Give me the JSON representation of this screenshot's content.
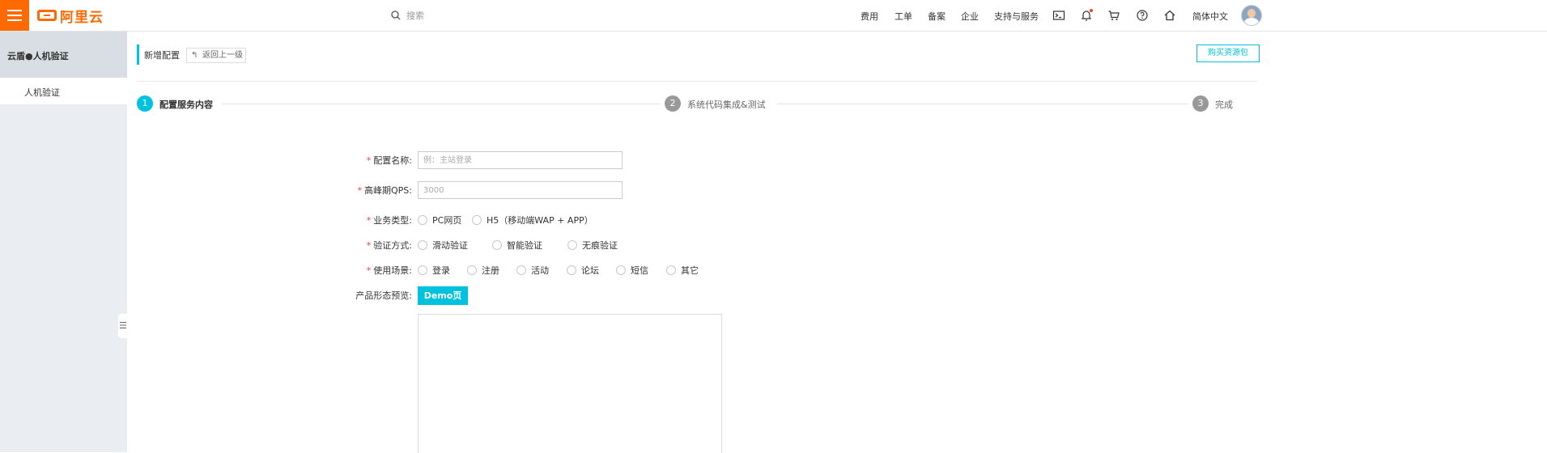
{
  "header": {
    "logo_text": "阿里云",
    "search_placeholder": "搜索",
    "nav": [
      "费用",
      "工单",
      "备案",
      "企业",
      "支持与服务"
    ],
    "icons": [
      "terminal-icon",
      "bell-icon",
      "cart-icon",
      "help-icon",
      "home-icon"
    ],
    "language": "简体中文"
  },
  "sidebar": {
    "title": "云盾●人机验证",
    "items": [
      {
        "label": "人机验证"
      }
    ]
  },
  "page": {
    "title": "新增配置",
    "back_label": "返回上一级",
    "buy_label": "购买资源包"
  },
  "steps": [
    {
      "num": "1",
      "label": "配置服务内容",
      "active": true
    },
    {
      "num": "2",
      "label": "系统代码集成&测试",
      "active": false
    },
    {
      "num": "3",
      "label": "完成",
      "active": false
    }
  ],
  "form": {
    "config_name": {
      "label": "配置名称:",
      "placeholder": "例：主站登录",
      "required": true
    },
    "peak_qps": {
      "label": "高峰期QPS:",
      "placeholder": "3000",
      "required": true
    },
    "business_type": {
      "label": "业务类型:",
      "required": true,
      "options": [
        "PC网页",
        "H5（移动端WAP + APP）"
      ]
    },
    "verify_method": {
      "label": "验证方式:",
      "required": true,
      "options": [
        "滑动验证",
        "智能验证",
        "无痕验证"
      ]
    },
    "scenario": {
      "label": "使用场景:",
      "required": true,
      "options": [
        "登录",
        "注册",
        "活动",
        "论坛",
        "短信",
        "其它"
      ]
    },
    "preview": {
      "label": "产品形态预览:",
      "button": "Demo页"
    }
  },
  "colors": {
    "brand": "#ff6a00",
    "accent": "#00c1de",
    "required": "#f04134"
  }
}
